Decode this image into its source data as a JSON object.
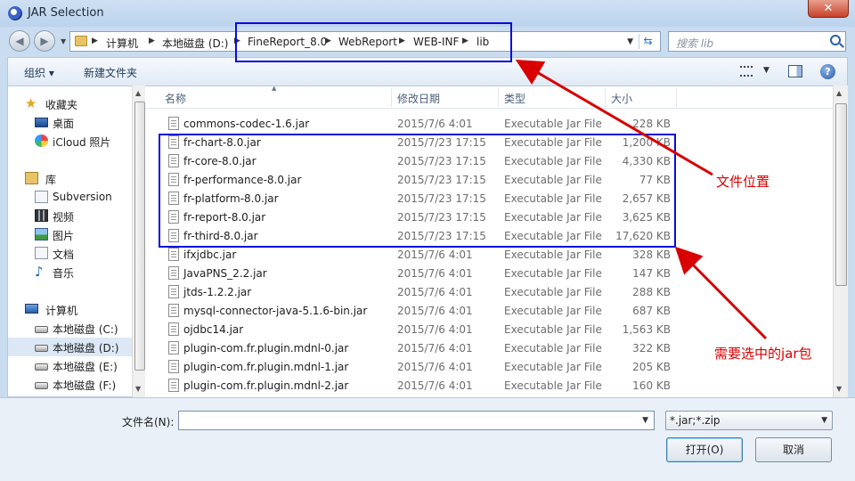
{
  "window": {
    "title": "JAR Selection",
    "close_glyph": "✕"
  },
  "address": {
    "crumbs": [
      "计算机",
      "本地磁盘 (D:)",
      "FineReport_8.0",
      "WebReport",
      "WEB-INF",
      "lib"
    ],
    "search_placeholder": "搜索 lib"
  },
  "toolbar": {
    "organize": "组织 ▾",
    "new_folder": "新建文件夹",
    "help_glyph": "?"
  },
  "nav": {
    "items": [
      {
        "label": "收藏夹",
        "icon": "star-icon"
      },
      {
        "label": "桌面",
        "icon": "desktop-icon"
      },
      {
        "label": "iCloud 照片",
        "icon": "icloud-photos-icon"
      },
      {
        "label": "库",
        "icon": "library-icon"
      },
      {
        "label": "Subversion",
        "icon": "folder-icon"
      },
      {
        "label": "视频",
        "icon": "video-icon"
      },
      {
        "label": "图片",
        "icon": "picture-icon"
      },
      {
        "label": "文档",
        "icon": "document-icon"
      },
      {
        "label": "音乐",
        "icon": "music-icon"
      },
      {
        "label": "计算机",
        "icon": "computer-icon"
      },
      {
        "label": "本地磁盘 (C:)",
        "icon": "drive-icon"
      },
      {
        "label": "本地磁盘 (D:)",
        "icon": "drive-icon",
        "selected": true
      },
      {
        "label": "本地磁盘 (E:)",
        "icon": "drive-icon"
      },
      {
        "label": "本地磁盘 (F:)",
        "icon": "drive-icon"
      }
    ]
  },
  "columns": {
    "name": "名称",
    "date": "修改日期",
    "type": "类型",
    "size": "大小"
  },
  "files": [
    {
      "name": "commons-codec-1.6.jar",
      "date": "2015/7/6 4:01",
      "type": "Executable Jar File",
      "size": "228 KB"
    },
    {
      "name": "fr-chart-8.0.jar",
      "date": "2015/7/23 17:15",
      "type": "Executable Jar File",
      "size": "1,200 KB"
    },
    {
      "name": "fr-core-8.0.jar",
      "date": "2015/7/23 17:15",
      "type": "Executable Jar File",
      "size": "4,330 KB"
    },
    {
      "name": "fr-performance-8.0.jar",
      "date": "2015/7/23 17:15",
      "type": "Executable Jar File",
      "size": "77 KB"
    },
    {
      "name": "fr-platform-8.0.jar",
      "date": "2015/7/23 17:15",
      "type": "Executable Jar File",
      "size": "2,657 KB"
    },
    {
      "name": "fr-report-8.0.jar",
      "date": "2015/7/23 17:15",
      "type": "Executable Jar File",
      "size": "3,625 KB"
    },
    {
      "name": "fr-third-8.0.jar",
      "date": "2015/7/23 17:15",
      "type": "Executable Jar File",
      "size": "17,620 KB"
    },
    {
      "name": "ifxjdbc.jar",
      "date": "2015/7/6 4:01",
      "type": "Executable Jar File",
      "size": "328 KB"
    },
    {
      "name": "JavaPNS_2.2.jar",
      "date": "2015/7/6 4:01",
      "type": "Executable Jar File",
      "size": "147 KB"
    },
    {
      "name": "jtds-1.2.2.jar",
      "date": "2015/7/6 4:01",
      "type": "Executable Jar File",
      "size": "288 KB"
    },
    {
      "name": "mysql-connector-java-5.1.6-bin.jar",
      "date": "2015/7/6 4:01",
      "type": "Executable Jar File",
      "size": "687 KB"
    },
    {
      "name": "ojdbc14.jar",
      "date": "2015/7/6 4:01",
      "type": "Executable Jar File",
      "size": "1,563 KB"
    },
    {
      "name": "plugin-com.fr.plugin.mdnl-0.jar",
      "date": "2015/7/6 4:01",
      "type": "Executable Jar File",
      "size": "322 KB"
    },
    {
      "name": "plugin-com.fr.plugin.mdnl-1.jar",
      "date": "2015/7/6 4:01",
      "type": "Executable Jar File",
      "size": "205 KB"
    },
    {
      "name": "plugin-com.fr.plugin.mdnl-2.jar",
      "date": "2015/7/6 4:01",
      "type": "Executable Jar File",
      "size": "160 KB"
    }
  ],
  "footer": {
    "filename_label": "文件名(N):",
    "filename_value": "",
    "filter_value": "*.jar;*.zip",
    "open_label": "打开(O)",
    "cancel_label": "取消"
  },
  "annotations": {
    "location_label": "文件位置",
    "jars_label": "需要选中的jar包",
    "color": "#d80000",
    "box_color": "#0a0adc"
  }
}
